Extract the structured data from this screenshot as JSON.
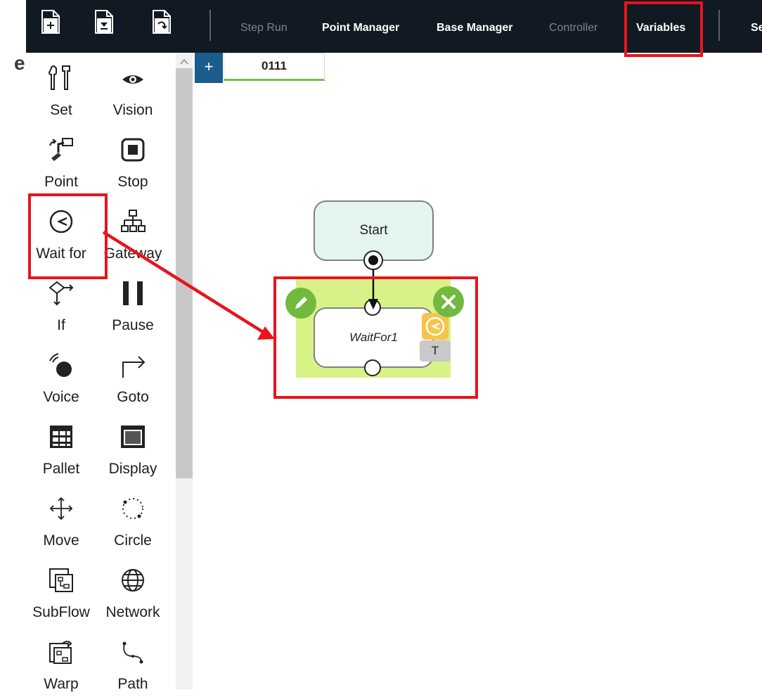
{
  "toolbar": {
    "icons": [
      "new-file-icon",
      "save-file-icon",
      "open-file-icon"
    ],
    "items": [
      {
        "label": "Step Run",
        "state": "disabled"
      },
      {
        "label": "Point Manager",
        "state": "enabled"
      },
      {
        "label": "Base Manager",
        "state": "enabled"
      },
      {
        "label": "Controller",
        "state": "disabled"
      },
      {
        "label": "Variables",
        "state": "highlighted"
      },
      {
        "label": "Se",
        "state": "enabled"
      }
    ]
  },
  "cut_letter": "e",
  "palette": {
    "items": [
      {
        "label": "Set",
        "icon": "tools-icon"
      },
      {
        "label": "Vision",
        "icon": "eye-icon"
      },
      {
        "label": "Point",
        "icon": "robot-arm-icon"
      },
      {
        "label": "Stop",
        "icon": "stop-icon"
      },
      {
        "label": "Wait for",
        "icon": "clock-icon"
      },
      {
        "label": "Gateway",
        "icon": "hierarchy-icon"
      },
      {
        "label": "If",
        "icon": "decision-icon"
      },
      {
        "label": "Pause",
        "icon": "pause-icon"
      },
      {
        "label": "Voice",
        "icon": "voice-icon"
      },
      {
        "label": "Goto",
        "icon": "goto-arrow-icon"
      },
      {
        "label": "Pallet",
        "icon": "grid-icon"
      },
      {
        "label": "Display",
        "icon": "display-icon"
      },
      {
        "label": "Move",
        "icon": "move-icon"
      },
      {
        "label": "Circle",
        "icon": "circle-dotted-icon"
      },
      {
        "label": "SubFlow",
        "icon": "subflow-icon"
      },
      {
        "label": "Network",
        "icon": "globe-icon"
      },
      {
        "label": "Warp",
        "icon": "warp-icon"
      },
      {
        "label": "Path",
        "icon": "path-icon"
      }
    ]
  },
  "tabs": {
    "add_label": "+",
    "items": [
      {
        "label": "0111",
        "active": true
      }
    ]
  },
  "flow": {
    "start_label": "Start",
    "wait_node_label": "WaitFor1",
    "wait_badge": "T"
  },
  "colors": {
    "toolbar_bg": "#111a22",
    "highlight_red": "#e8141c",
    "node_selected_bg": "#d7f287",
    "action_green": "#71b93f",
    "tab_accent": "#78bd4d",
    "add_tab_blue": "#1a5c8c"
  }
}
